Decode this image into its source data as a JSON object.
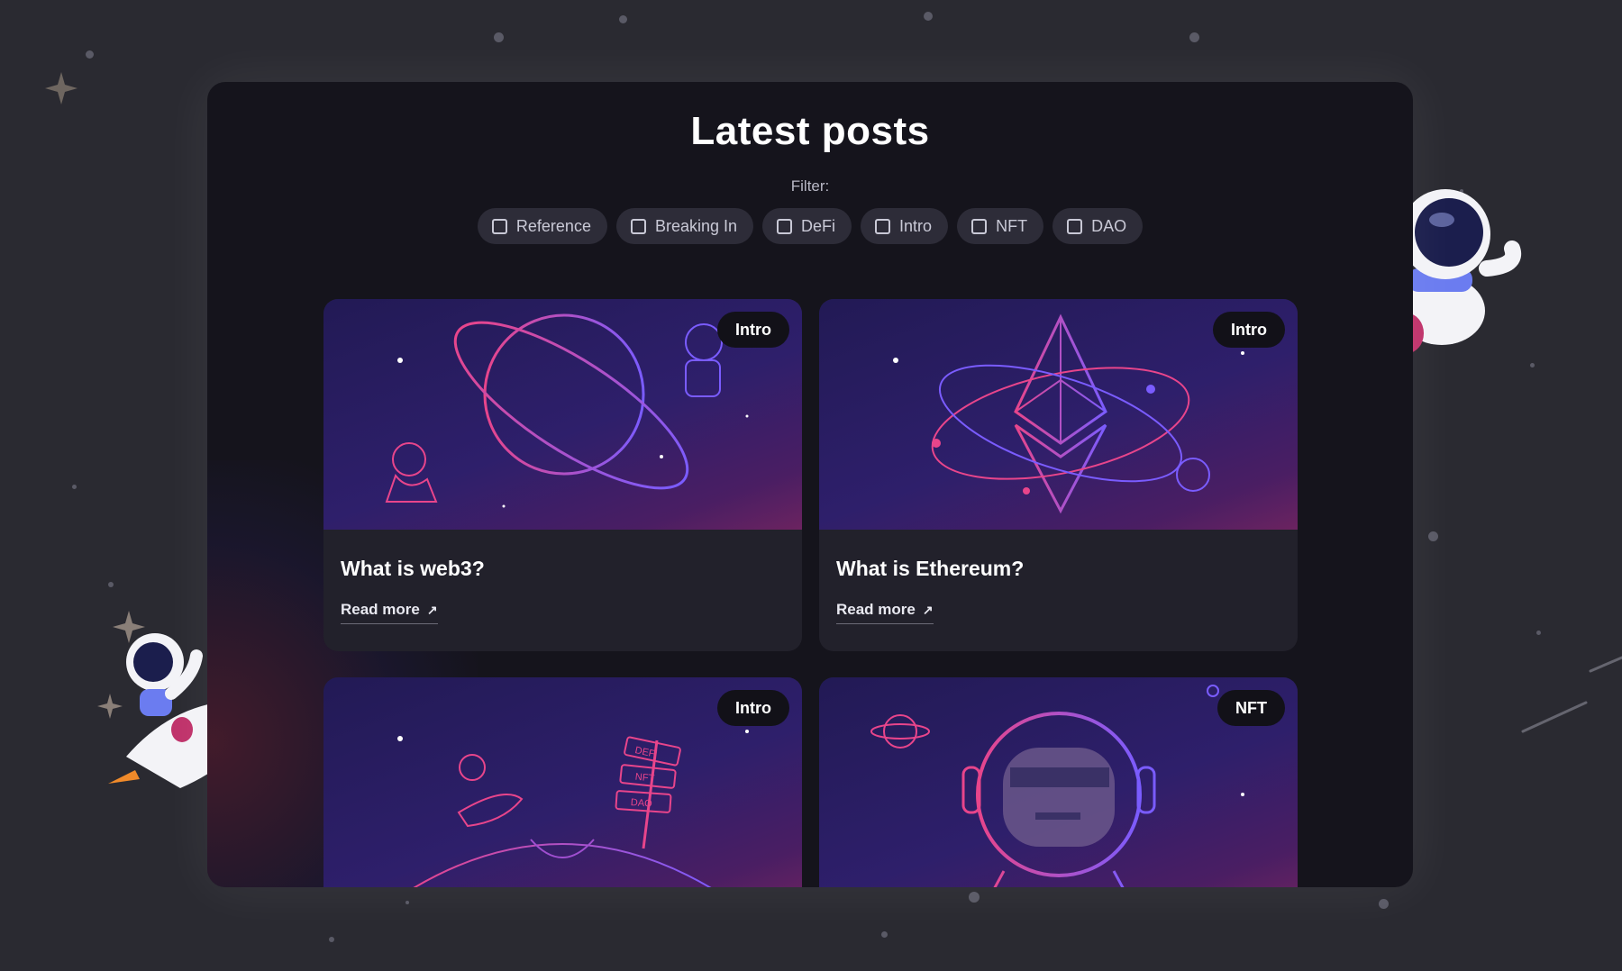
{
  "page": {
    "title": "Latest posts",
    "filter_label": "Filter:"
  },
  "filters": [
    {
      "label": "Reference"
    },
    {
      "label": "Breaking In"
    },
    {
      "label": "DeFi"
    },
    {
      "label": "Intro"
    },
    {
      "label": "NFT"
    },
    {
      "label": "DAO"
    }
  ],
  "posts": [
    {
      "tag": "Intro",
      "title": "What is web3?",
      "read_more": "Read more",
      "illustration": "planet-with-astronauts"
    },
    {
      "tag": "Intro",
      "title": "What is Ethereum?",
      "read_more": "Read more",
      "illustration": "ethereum-orbit"
    },
    {
      "tag": "Intro",
      "illustration": "signpost-defi-nft-dao",
      "signs": [
        "DEFI",
        "NFT",
        "DAO"
      ]
    },
    {
      "tag": "NFT",
      "illustration": "pixel-ape-astronaut"
    }
  ],
  "colors": {
    "accent_pink": "#e8458b",
    "accent_purple": "#7a5cff",
    "panel": "#15141c",
    "card": "#22212b"
  },
  "icons": {
    "read_more": "arrow-up-right-icon",
    "checkbox": "checkbox-empty-icon"
  }
}
